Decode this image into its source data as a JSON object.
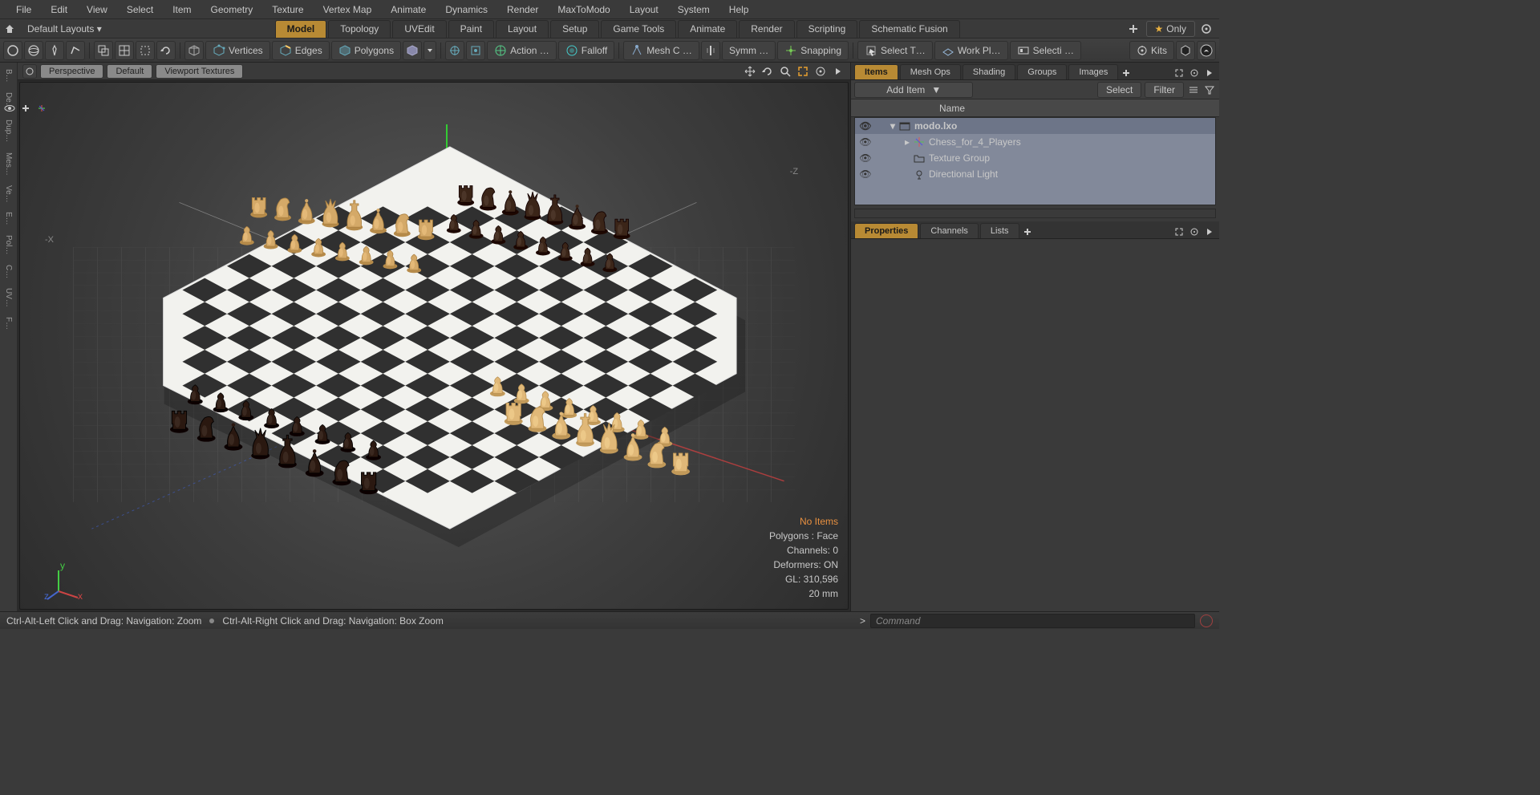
{
  "menu": [
    "File",
    "Edit",
    "View",
    "Select",
    "Item",
    "Geometry",
    "Texture",
    "Vertex Map",
    "Animate",
    "Dynamics",
    "Render",
    "MaxToModo",
    "Layout",
    "System",
    "Help"
  ],
  "layout_dropdown": "Default Layouts ▾",
  "layout_tabs": [
    "Model",
    "Topology",
    "UVEdit",
    "Paint",
    "Layout",
    "Setup",
    "Game Tools",
    "Animate",
    "Render",
    "Scripting",
    "Schematic Fusion"
  ],
  "layout_tabs_active": 0,
  "only_label": "Only",
  "toolbar": {
    "vertices": "Vertices",
    "edges": "Edges",
    "polygons": "Polygons",
    "action": "Action   …",
    "falloff": "Falloff",
    "meshc": "Mesh C …",
    "symm": "Symm …",
    "snapping": "Snapping",
    "selectt": "Select T…",
    "workpl": "Work Pl…",
    "selecti": "Selecti …",
    "kits": "Kits"
  },
  "viewport": {
    "tabs": [
      "Perspective",
      "Default",
      "Viewport Textures"
    ],
    "overlay": {
      "no_items": "No Items",
      "polys": "Polygons : Face",
      "channels": "Channels: 0",
      "deformers": "Deformers: ON",
      "gl": "GL: 310,596",
      "units": "20 mm"
    },
    "neg_x": "-X",
    "neg_z": "-Z",
    "gizmo": {
      "x": "x",
      "y": "y",
      "z": "z"
    }
  },
  "sidestrip": [
    "B…",
    "De…",
    "Dup…",
    "Mes…",
    "Ve…",
    "E…",
    "Pol…",
    "C…",
    "UV…",
    "F…"
  ],
  "items_panel": {
    "tabs": [
      "Items",
      "Mesh Ops",
      "Shading",
      "Groups",
      "Images"
    ],
    "active_tab": 0,
    "add_item": "Add Item",
    "select": "Select",
    "filter": "Filter",
    "name_col": "Name",
    "tree": [
      {
        "indent": 0,
        "label": "modo.lxo",
        "icon": "scene",
        "selected": true,
        "expand": "▾"
      },
      {
        "indent": 1,
        "label": "Chess_for_4_Players",
        "icon": "locator",
        "expand": "▸"
      },
      {
        "indent": 1,
        "label": "Texture Group",
        "icon": "folder",
        "expand": ""
      },
      {
        "indent": 1,
        "label": "Directional Light",
        "icon": "light",
        "expand": ""
      }
    ]
  },
  "lower_panel": {
    "tabs": [
      "Properties",
      "Channels",
      "Lists"
    ],
    "active_tab": 0
  },
  "status": {
    "hint1": "Ctrl-Alt-Left Click and Drag: Navigation: Zoom",
    "hint2": "Ctrl-Alt-Right Click and Drag: Navigation: Box Zoom",
    "cmd_placeholder": "Command",
    "prompt": ">"
  }
}
